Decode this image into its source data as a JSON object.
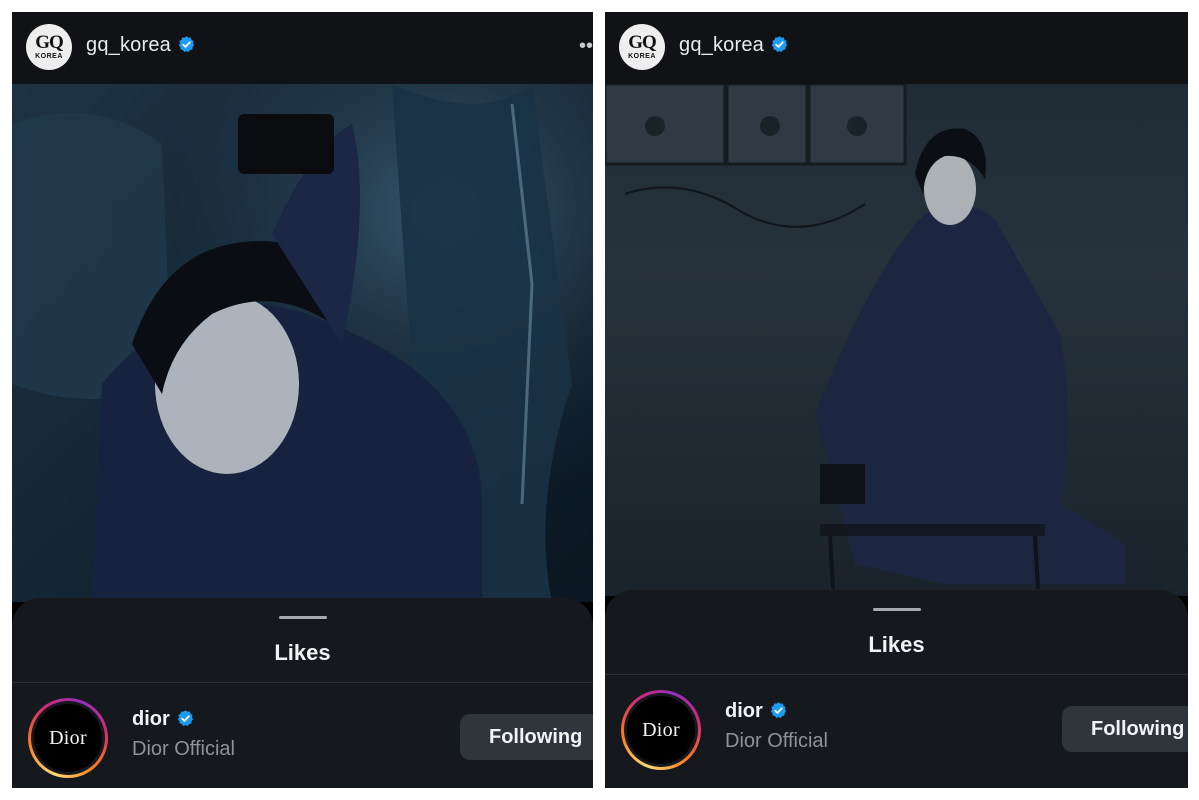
{
  "panels": [
    {
      "account": {
        "username": "gq_korea",
        "verified": true,
        "logo_text": "GQ",
        "logo_subtext": "KOREA"
      },
      "sheet_title": "Likes",
      "like_entry": {
        "username": "dior",
        "verified": true,
        "display_name": "Dior Official",
        "avatar_text": "Dior",
        "button_label": "Following"
      }
    },
    {
      "account": {
        "username": "gq_korea",
        "verified": true,
        "logo_text": "GQ",
        "logo_subtext": "KOREA"
      },
      "sheet_title": "Likes",
      "like_entry": {
        "username": "dior",
        "verified": true,
        "display_name": "Dior Official",
        "avatar_text": "Dior",
        "button_label": "Following"
      }
    }
  ],
  "colors": {
    "verified_badge": "#1d9bf0",
    "panel_bg": "#15181d",
    "button_bg": "#30343b",
    "ring_gradient": [
      "#feda75",
      "#fa7e1e",
      "#d62976",
      "#962fbf"
    ]
  },
  "icons": {
    "verified": "verified-badge-icon",
    "more": "more-options-icon"
  }
}
